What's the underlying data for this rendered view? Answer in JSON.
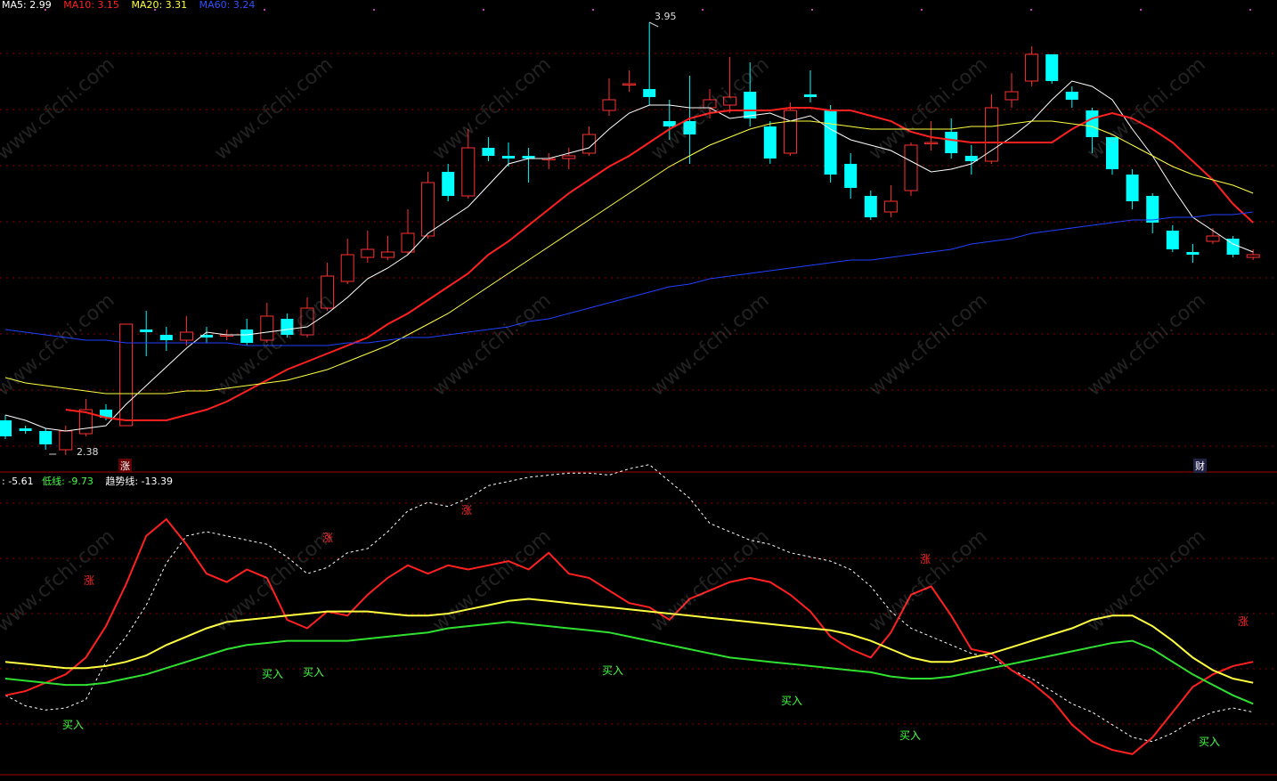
{
  "legend_top": {
    "ma5": {
      "label": "MA5: 2.99",
      "color": "#ffffff"
    },
    "ma10": {
      "label": "MA10: 3.15",
      "color": "#ff2020"
    },
    "ma20": {
      "label": "MA20: 3.31",
      "color": "#ffff40"
    },
    "ma60": {
      "label": "MA60: 3.24",
      "color": "#2040ff"
    }
  },
  "legend_bottom": {
    "first": {
      "label": ": -5.61",
      "color": "#ffffff"
    },
    "low": {
      "label": "低线: -9.73",
      "color": "#40ff40"
    },
    "trend": {
      "label": "趋势线: -13.39",
      "color": "#ffffff"
    }
  },
  "annotations": {
    "high_label": "3.95",
    "low_label": "2.38",
    "axis_zhang": "涨",
    "axis_cai": "财"
  },
  "signals": {
    "up": "涨",
    "buy": "买入"
  },
  "watermark": "www.cfchi.com",
  "colors": {
    "up_candle": "#ff3030",
    "down_candle": "#00ffff",
    "grid": "#8b0000",
    "buy_text": "#40ff40",
    "up_text": "#ff2020"
  },
  "chart_data": [
    {
      "type": "candlestick",
      "title": "",
      "ylim": [
        2.3,
        4.0
      ],
      "candles": [
        {
          "o": 2.46,
          "c": 2.4,
          "h": 2.48,
          "l": 2.39
        },
        {
          "o": 2.43,
          "c": 2.42,
          "h": 2.44,
          "l": 2.41
        },
        {
          "o": 2.42,
          "c": 2.37,
          "h": 2.43,
          "l": 2.35
        },
        {
          "o": 2.35,
          "c": 2.42,
          "h": 2.44,
          "l": 2.33
        },
        {
          "o": 2.41,
          "c": 2.5,
          "h": 2.54,
          "l": 2.4
        },
        {
          "o": 2.5,
          "c": 2.47,
          "h": 2.52,
          "l": 2.46
        },
        {
          "o": 2.44,
          "c": 2.82,
          "h": 2.82,
          "l": 2.44
        },
        {
          "o": 2.8,
          "c": 2.79,
          "h": 2.87,
          "l": 2.7
        },
        {
          "o": 2.78,
          "c": 2.76,
          "h": 2.81,
          "l": 2.72
        },
        {
          "o": 2.76,
          "c": 2.79,
          "h": 2.85,
          "l": 2.74
        },
        {
          "o": 2.78,
          "c": 2.77,
          "h": 2.81,
          "l": 2.75
        },
        {
          "o": 2.78,
          "c": 2.78,
          "h": 2.8,
          "l": 2.76
        },
        {
          "o": 2.8,
          "c": 2.75,
          "h": 2.84,
          "l": 2.74
        },
        {
          "o": 2.76,
          "c": 2.85,
          "h": 2.9,
          "l": 2.75
        },
        {
          "o": 2.84,
          "c": 2.78,
          "h": 2.86,
          "l": 2.77
        },
        {
          "o": 2.78,
          "c": 2.88,
          "h": 2.92,
          "l": 2.77
        },
        {
          "o": 2.88,
          "c": 3.0,
          "h": 3.05,
          "l": 2.87
        },
        {
          "o": 2.98,
          "c": 3.08,
          "h": 3.14,
          "l": 2.97
        },
        {
          "o": 3.07,
          "c": 3.1,
          "h": 3.17,
          "l": 3.05
        },
        {
          "o": 3.07,
          "c": 3.09,
          "h": 3.15,
          "l": 3.06
        },
        {
          "o": 3.09,
          "c": 3.16,
          "h": 3.25,
          "l": 3.08
        },
        {
          "o": 3.15,
          "c": 3.35,
          "h": 3.39,
          "l": 3.14
        },
        {
          "o": 3.39,
          "c": 3.3,
          "h": 3.42,
          "l": 3.28
        },
        {
          "o": 3.3,
          "c": 3.48,
          "h": 3.55,
          "l": 3.29
        },
        {
          "o": 3.48,
          "c": 3.45,
          "h": 3.52,
          "l": 3.43
        },
        {
          "o": 3.45,
          "c": 3.44,
          "h": 3.5,
          "l": 3.41
        },
        {
          "o": 3.45,
          "c": 3.44,
          "h": 3.48,
          "l": 3.35
        },
        {
          "o": 3.44,
          "c": 3.44,
          "h": 3.46,
          "l": 3.4
        },
        {
          "o": 3.44,
          "c": 3.45,
          "h": 3.48,
          "l": 3.4
        },
        {
          "o": 3.46,
          "c": 3.53,
          "h": 3.56,
          "l": 3.45
        },
        {
          "o": 3.62,
          "c": 3.66,
          "h": 3.74,
          "l": 3.6
        },
        {
          "o": 3.72,
          "c": 3.72,
          "h": 3.77,
          "l": 3.69
        },
        {
          "o": 3.7,
          "c": 3.67,
          "h": 3.95,
          "l": 3.64
        },
        {
          "o": 3.58,
          "c": 3.56,
          "h": 3.66,
          "l": 3.51
        },
        {
          "o": 3.58,
          "c": 3.53,
          "h": 3.75,
          "l": 3.42
        },
        {
          "o": 3.63,
          "c": 3.66,
          "h": 3.7,
          "l": 3.59
        },
        {
          "o": 3.64,
          "c": 3.67,
          "h": 3.82,
          "l": 3.61
        },
        {
          "o": 3.69,
          "c": 3.59,
          "h": 3.8,
          "l": 3.56
        },
        {
          "o": 3.56,
          "c": 3.44,
          "h": 3.58,
          "l": 3.42
        },
        {
          "o": 3.46,
          "c": 3.62,
          "h": 3.65,
          "l": 3.45
        },
        {
          "o": 3.68,
          "c": 3.67,
          "h": 3.77,
          "l": 3.65
        },
        {
          "o": 3.62,
          "c": 3.38,
          "h": 3.64,
          "l": 3.35
        },
        {
          "o": 3.42,
          "c": 3.33,
          "h": 3.46,
          "l": 3.29
        },
        {
          "o": 3.3,
          "c": 3.22,
          "h": 3.32,
          "l": 3.21
        },
        {
          "o": 3.24,
          "c": 3.28,
          "h": 3.34,
          "l": 3.22
        },
        {
          "o": 3.32,
          "c": 3.49,
          "h": 3.5,
          "l": 3.3
        },
        {
          "o": 3.5,
          "c": 3.5,
          "h": 3.58,
          "l": 3.47
        },
        {
          "o": 3.54,
          "c": 3.46,
          "h": 3.59,
          "l": 3.44
        },
        {
          "o": 3.45,
          "c": 3.43,
          "h": 3.49,
          "l": 3.38
        },
        {
          "o": 3.43,
          "c": 3.63,
          "h": 3.68,
          "l": 3.42
        },
        {
          "o": 3.66,
          "c": 3.69,
          "h": 3.76,
          "l": 3.63
        },
        {
          "o": 3.73,
          "c": 3.83,
          "h": 3.86,
          "l": 3.71
        },
        {
          "o": 3.83,
          "c": 3.73,
          "h": 3.83,
          "l": 3.72
        },
        {
          "o": 3.69,
          "c": 3.66,
          "h": 3.71,
          "l": 3.63
        },
        {
          "o": 3.62,
          "c": 3.52,
          "h": 3.63,
          "l": 3.46
        },
        {
          "o": 3.52,
          "c": 3.4,
          "h": 3.52,
          "l": 3.38
        },
        {
          "o": 3.38,
          "c": 3.28,
          "h": 3.4,
          "l": 3.25
        },
        {
          "o": 3.3,
          "c": 3.2,
          "h": 3.31,
          "l": 3.16
        },
        {
          "o": 3.17,
          "c": 3.1,
          "h": 3.19,
          "l": 3.09
        },
        {
          "o": 3.09,
          "c": 3.08,
          "h": 3.12,
          "l": 3.05
        },
        {
          "o": 3.13,
          "c": 3.15,
          "h": 3.18,
          "l": 3.12
        },
        {
          "o": 3.14,
          "c": 3.08,
          "h": 3.15,
          "l": 3.07
        },
        {
          "o": 3.07,
          "c": 3.08,
          "h": 3.1,
          "l": 3.06
        }
      ],
      "series": [
        {
          "name": "MA5",
          "values": [
            2.48,
            2.46,
            2.43,
            2.42,
            2.43,
            2.44,
            2.52,
            2.59,
            2.66,
            2.73,
            2.79,
            2.78,
            2.78,
            2.79,
            2.8,
            2.81,
            2.86,
            2.92,
            2.99,
            3.03,
            3.08,
            3.16,
            3.21,
            3.26,
            3.34,
            3.42,
            3.44,
            3.44,
            3.46,
            3.48,
            3.55,
            3.61,
            3.64,
            3.64,
            3.63,
            3.63,
            3.59,
            3.6,
            3.61,
            3.58,
            3.6,
            3.55,
            3.51,
            3.49,
            3.47,
            3.43,
            3.39,
            3.4,
            3.42,
            3.47,
            3.52,
            3.58,
            3.66,
            3.73,
            3.71,
            3.66,
            3.55,
            3.45,
            3.33,
            3.22,
            3.17,
            3.12,
            3.09
          ]
        },
        {
          "name": "MA10",
          "values": [
            2.5,
            2.49,
            2.47,
            2.46,
            2.46,
            2.46,
            2.48,
            2.5,
            2.53,
            2.57,
            2.61,
            2.65,
            2.68,
            2.71,
            2.74,
            2.77,
            2.82,
            2.86,
            2.91,
            2.96,
            3.01,
            3.08,
            3.13,
            3.19,
            3.25,
            3.31,
            3.36,
            3.41,
            3.45,
            3.5,
            3.55,
            3.59,
            3.61,
            3.62,
            3.62,
            3.62,
            3.63,
            3.63,
            3.62,
            3.62,
            3.6,
            3.58,
            3.54,
            3.52,
            3.51,
            3.5,
            3.5,
            3.5,
            3.5,
            3.5,
            3.55,
            3.59,
            3.61,
            3.59,
            3.55,
            3.5,
            3.43,
            3.36,
            3.27,
            3.2
          ]
        },
        {
          "name": "MA20",
          "values": [
            2.62,
            2.6,
            2.59,
            2.58,
            2.57,
            2.56,
            2.56,
            2.56,
            2.56,
            2.57,
            2.57,
            2.58,
            2.59,
            2.6,
            2.61,
            2.63,
            2.65,
            2.68,
            2.71,
            2.74,
            2.78,
            2.82,
            2.86,
            2.91,
            2.96,
            3.01,
            3.06,
            3.11,
            3.16,
            3.21,
            3.26,
            3.31,
            3.36,
            3.41,
            3.45,
            3.49,
            3.52,
            3.55,
            3.57,
            3.58,
            3.58,
            3.57,
            3.56,
            3.55,
            3.55,
            3.55,
            3.55,
            3.55,
            3.56,
            3.56,
            3.57,
            3.58,
            3.58,
            3.57,
            3.56,
            3.53,
            3.49,
            3.45,
            3.41,
            3.38,
            3.36,
            3.34,
            3.31
          ]
        },
        {
          "name": "MA60",
          "values": [
            2.8,
            2.79,
            2.78,
            2.77,
            2.76,
            2.76,
            2.75,
            2.75,
            2.75,
            2.75,
            2.75,
            2.75,
            2.74,
            2.74,
            2.74,
            2.74,
            2.74,
            2.75,
            2.75,
            2.76,
            2.77,
            2.77,
            2.78,
            2.79,
            2.8,
            2.81,
            2.83,
            2.84,
            2.86,
            2.88,
            2.9,
            2.92,
            2.94,
            2.96,
            2.97,
            2.99,
            3.0,
            3.01,
            3.02,
            3.03,
            3.04,
            3.05,
            3.06,
            3.06,
            3.07,
            3.08,
            3.09,
            3.1,
            3.12,
            3.13,
            3.14,
            3.16,
            3.17,
            3.18,
            3.19,
            3.2,
            3.21,
            3.21,
            3.22,
            3.22,
            3.23,
            3.23,
            3.24
          ]
        }
      ]
    },
    {
      "type": "line",
      "title": "",
      "ylim": [
        -25,
        110
      ],
      "series": [
        {
          "name": "",
          "dashed": true,
          "color": "#ffffff",
          "values": [
            12,
            7,
            5,
            6,
            10,
            28,
            40,
            55,
            75,
            88,
            90,
            88,
            86,
            84,
            78,
            70,
            73,
            80,
            82,
            90,
            100,
            104,
            102,
            106,
            112,
            114,
            116,
            117,
            118,
            118,
            117,
            120,
            122,
            114,
            106,
            94,
            90,
            86,
            84,
            80,
            78,
            76,
            72,
            64,
            52,
            44,
            40,
            36,
            32,
            30,
            24,
            20,
            14,
            8,
            4,
            -2,
            -8,
            -10,
            -6,
            0,
            4,
            6,
            4
          ]
        },
        {
          "name": "",
          "color": "#ff2020",
          "values": [
            12,
            14,
            18,
            22,
            30,
            45,
            65,
            88,
            96,
            84,
            70,
            66,
            72,
            68,
            48,
            44,
            52,
            50,
            60,
            68,
            74,
            70,
            74,
            72,
            74,
            76,
            72,
            80,
            70,
            68,
            62,
            56,
            54,
            48,
            58,
            62,
            66,
            68,
            66,
            60,
            52,
            40,
            34,
            30,
            42,
            60,
            64,
            50,
            34,
            32,
            24,
            18,
            10,
            -2,
            -10,
            -14,
            -16,
            -8,
            4,
            16,
            22,
            26,
            28
          ]
        },
        {
          "name": "",
          "color": "#ffff40",
          "values": [
            28,
            27,
            26,
            25,
            25,
            26,
            28,
            31,
            36,
            40,
            44,
            47,
            48,
            49,
            50,
            51,
            52,
            52,
            52,
            51,
            50,
            50,
            51,
            53,
            55,
            57,
            58,
            57,
            56,
            55,
            54,
            53,
            52,
            51,
            50,
            49,
            48,
            47,
            46,
            45,
            44,
            43,
            41,
            38,
            34,
            30,
            28,
            28,
            30,
            32,
            35,
            38,
            41,
            44,
            48,
            50,
            50,
            45,
            38,
            30,
            24,
            20,
            18
          ]
        },
        {
          "name": "",
          "color": "#30e030",
          "values": [
            20,
            19,
            18,
            17,
            17,
            18,
            20,
            22,
            25,
            28,
            31,
            34,
            36,
            37,
            38,
            38,
            38,
            38,
            39,
            40,
            41,
            42,
            44,
            45,
            46,
            47,
            46,
            45,
            44,
            43,
            42,
            40,
            38,
            36,
            34,
            32,
            30,
            29,
            28,
            27,
            26,
            25,
            24,
            23,
            21,
            20,
            20,
            21,
            23,
            25,
            27,
            29,
            31,
            33,
            35,
            37,
            38,
            34,
            28,
            22,
            17,
            12,
            8
          ]
        }
      ]
    }
  ]
}
